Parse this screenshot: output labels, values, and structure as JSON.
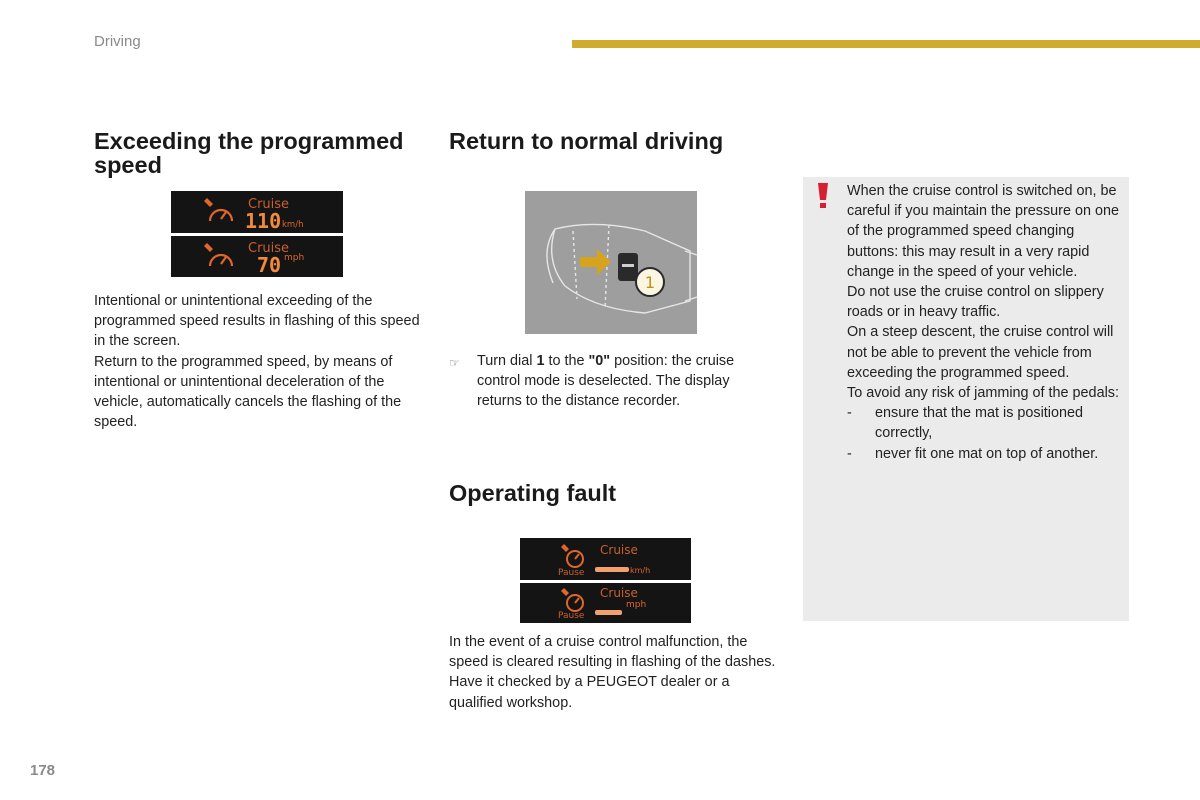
{
  "header": {
    "section": "Driving",
    "accent_color": "#cfac2e"
  },
  "col1": {
    "title": "Exceeding the programmed speed",
    "displays": [
      {
        "mode": "Cruise",
        "speed": "110",
        "unit": "km/h"
      },
      {
        "mode": "Cruise",
        "speed": "70",
        "unit": "mph"
      }
    ],
    "paragraphs": [
      "Intentional or unintentional exceeding of the programmed speed results in flashing of this speed in the screen.",
      "Return to the programmed speed, by means of intentional or unintentional deceleration of the vehicle, automatically cancels the flashing of the speed."
    ]
  },
  "col2": {
    "title": "Return to normal driving",
    "illustration": {
      "callout_number": "1",
      "arrow_color": "#d6a41c"
    },
    "instruction": {
      "icon": "pointing-hand-icon",
      "pre": "Turn dial ",
      "dial": "1",
      "mid": " to the ",
      "position": "\"0\"",
      "post": " position: the cruise control mode is deselected. The display returns to the distance recorder."
    },
    "fault_title": "Operating fault",
    "fault_displays": [
      {
        "mode": "Cruise",
        "status": "Pause",
        "speed": "---",
        "unit": "km/h"
      },
      {
        "mode": "Cruise",
        "status": "Pause",
        "speed": "---",
        "unit": "mph"
      }
    ],
    "fault_paragraphs": [
      "In the event of a cruise control malfunction, the speed is cleared resulting in flashing of the dashes.",
      "Have it checked by a PEUGEOT dealer or a qualified workshop."
    ]
  },
  "warning": {
    "icon": "exclamation-icon",
    "icon_color": "#d6202f",
    "paragraphs": [
      "When the cruise control is switched on, be careful if you maintain the pressure on one of the programmed speed changing buttons: this may result in a very rapid change in the speed of your vehicle.",
      "Do not use the cruise control on slippery roads or in heavy traffic.",
      "On a steep descent, the cruise control will not be able to prevent the vehicle from exceeding the programmed speed.",
      "To avoid any risk of jamming of the pedals:"
    ],
    "list": [
      "ensure that the mat is positioned correctly,",
      "never fit one mat on top of another."
    ],
    "list_marker": "-"
  },
  "footer": {
    "page_number": "178"
  }
}
